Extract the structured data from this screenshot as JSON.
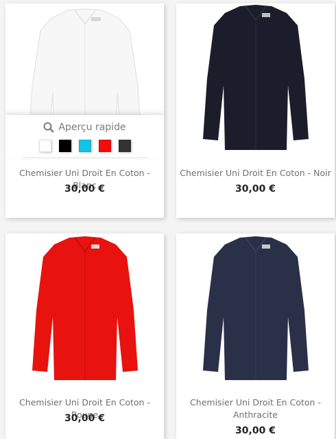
{
  "products": [
    {
      "name": "Chemisier Uni Droit En Coton - Blanc",
      "price": "30,00 €",
      "shirt_color": "#f7f7f7"
    },
    {
      "name": "Chemisier Uni Droit En Coton - Noir",
      "price": "30,00 €",
      "shirt_color": "#1b1e2a"
    },
    {
      "name": "Chemisier Uni Droit En Coton - Rouge",
      "price": "30,00 €",
      "shirt_color": "#e8120f"
    },
    {
      "name": "Chemisier Uni Droit En Coton - Anthracite",
      "price": "30,00 €",
      "shirt_color": "#2b3049"
    }
  ],
  "quick_view": {
    "label": "Aperçu rapide",
    "icon": "search-icon",
    "swatches": [
      "#ffffff",
      "#000000",
      "#12c3e8",
      "#f40b0b",
      "#333333"
    ]
  }
}
